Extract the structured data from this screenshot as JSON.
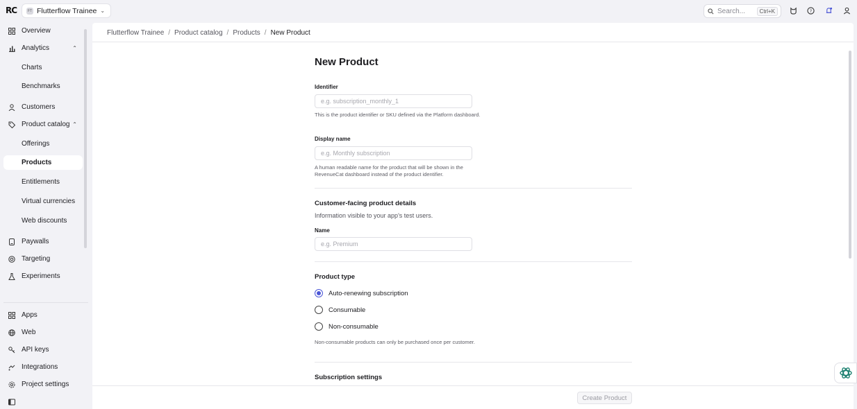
{
  "topbar": {
    "logo": "RC",
    "project": {
      "initials": "FT",
      "name": "Flutterflow Trainee"
    },
    "search": {
      "placeholder": "Search...",
      "shortcut": "Ctrl+K"
    },
    "icons": [
      "beta-cat-icon",
      "help-icon",
      "notifications-icon",
      "account-icon"
    ]
  },
  "sidebar": {
    "items": [
      {
        "label": "Overview",
        "icon": "grid-icon"
      },
      {
        "label": "Analytics",
        "icon": "bar-chart-icon",
        "expanded": true
      },
      {
        "label": "Charts"
      },
      {
        "label": "Benchmarks"
      },
      {
        "label": "Customers",
        "icon": "person-icon"
      },
      {
        "label": "Product catalog",
        "icon": "tag-icon",
        "expanded": true
      },
      {
        "label": "Offerings"
      },
      {
        "label": "Products",
        "active": true
      },
      {
        "label": "Entitlements"
      },
      {
        "label": "Virtual currencies"
      },
      {
        "label": "Web discounts"
      },
      {
        "label": "Paywalls",
        "icon": "paywall-icon"
      },
      {
        "label": "Targeting",
        "icon": "target-icon"
      },
      {
        "label": "Experiments",
        "icon": "flask-icon"
      },
      {
        "label": "Apps",
        "icon": "apps-icon"
      },
      {
        "label": "Web",
        "icon": "globe-icon"
      },
      {
        "label": "API keys",
        "icon": "key-icon"
      },
      {
        "label": "Integrations",
        "icon": "integrations-icon"
      },
      {
        "label": "Project settings",
        "icon": "settings-icon"
      }
    ],
    "collapse_icon": "sidebar-toggle-icon"
  },
  "breadcrumb": [
    "Flutterflow Trainee",
    "Product catalog",
    "Products",
    "New Product"
  ],
  "form": {
    "title": "New Product",
    "identifier": {
      "label": "Identifier",
      "placeholder": "e.g. subscription_monthly_1",
      "help": "This is the product identifier or SKU defined via the Platform dashboard."
    },
    "display_name": {
      "label": "Display name",
      "placeholder": "e.g. Monthly subscription",
      "help": "A human readable name for the product that will be shown in the RevenueCat dashboard instead of the product identifier."
    },
    "customer_section": {
      "title": "Customer-facing product details",
      "subtitle": "Information visible to your app's test users.",
      "name_label": "Name",
      "name_placeholder": "e.g. Premium"
    },
    "product_type": {
      "title": "Product type",
      "options": [
        {
          "label": "Auto-renewing subscription",
          "checked": true
        },
        {
          "label": "Consumable",
          "checked": false
        },
        {
          "label": "Non-consumable",
          "checked": false
        }
      ],
      "help": "Non-consumable products can only be purchased once per customer."
    },
    "subscription_settings_title": "Subscription settings"
  },
  "footer": {
    "create_label": "Create Product"
  },
  "colors": {
    "accent": "#4a55d6",
    "assistant": "#1a7f6f",
    "app_bg": "#f2f2f6"
  }
}
